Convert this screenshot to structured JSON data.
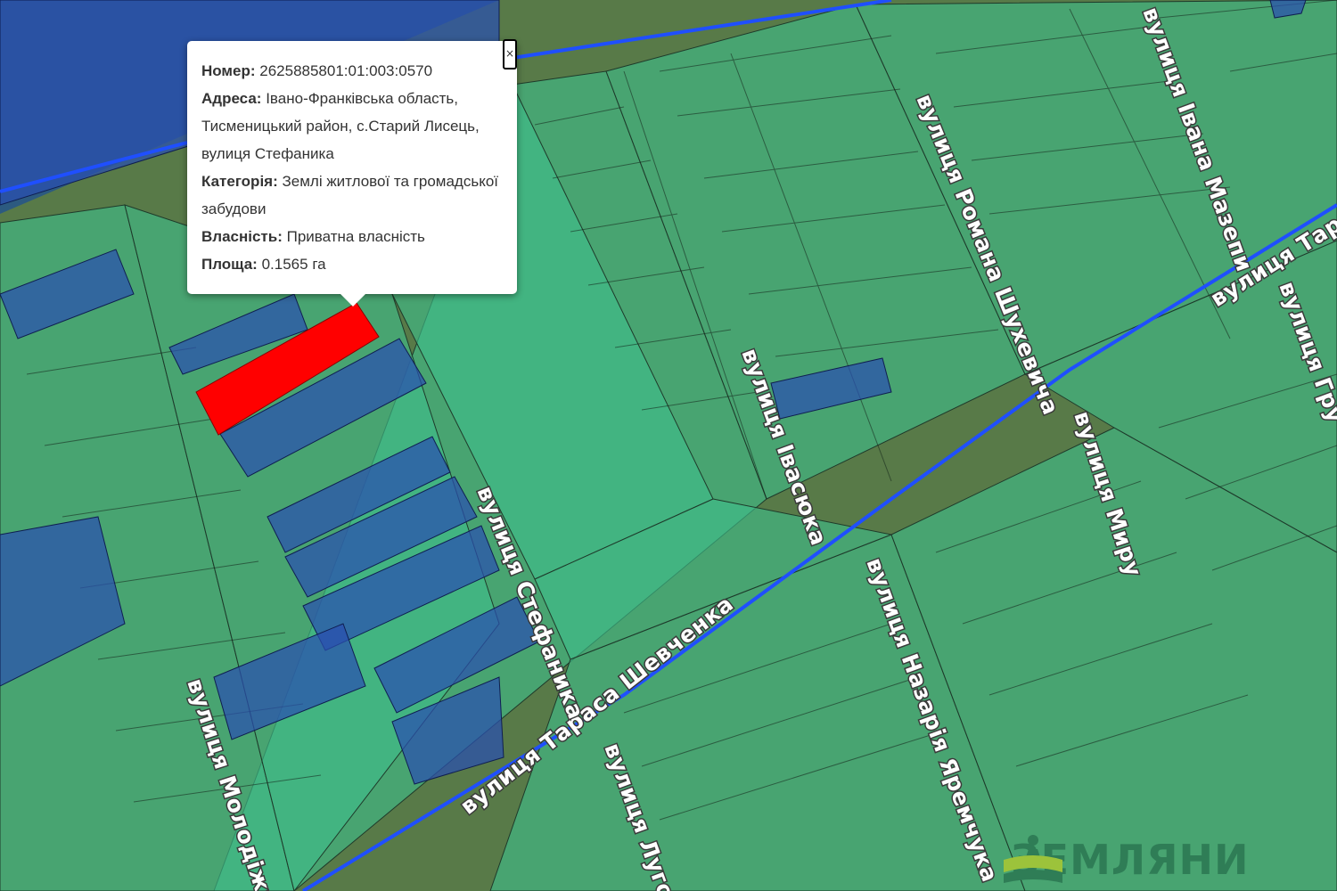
{
  "popup": {
    "number_label": "Номер:",
    "number_value": "2625885801:01:003:0570",
    "address_label": "Адреса:",
    "address_value": "Івано-Франківська область, Тисменицький район, с.Старий Лисець, вулиця Стефаника",
    "category_label": "Категорія:",
    "category_value": "Землі житлової та громадської забудови",
    "ownership_label": "Власність:",
    "ownership_value": "Приватна власність",
    "area_label": "Площа:",
    "area_value": "0.1565 га",
    "close_label": "×"
  },
  "streets": {
    "shevchenka": "вулиця Тараса Шевченка",
    "stefanyka": "вулиця Стефаника",
    "ivasiuka": "вулиця Івасюка",
    "shukhevycha": "вулиця Романа Шухевича",
    "mazepy": "вулиця Івана Мазепи",
    "myru": "вулиця Миру",
    "molodizhna": "вулиця Молодіжна",
    "luhova": "вулиця Лугова",
    "yaremchuka": "вулиця Назарія Яремчука",
    "tarasa_top": "вулиця Тара",
    "hrushevskoho_part": "вулиця Гру"
  },
  "logo": {
    "text": "ЗЕМЛЯНИ"
  },
  "colors": {
    "residential_parcel": "#3fbf8a",
    "agricultural_parcel": "#2a4fb0",
    "selected_parcel": "#ff0000",
    "road_line": "#1f4fff",
    "logo_green": "#2f7d56"
  }
}
